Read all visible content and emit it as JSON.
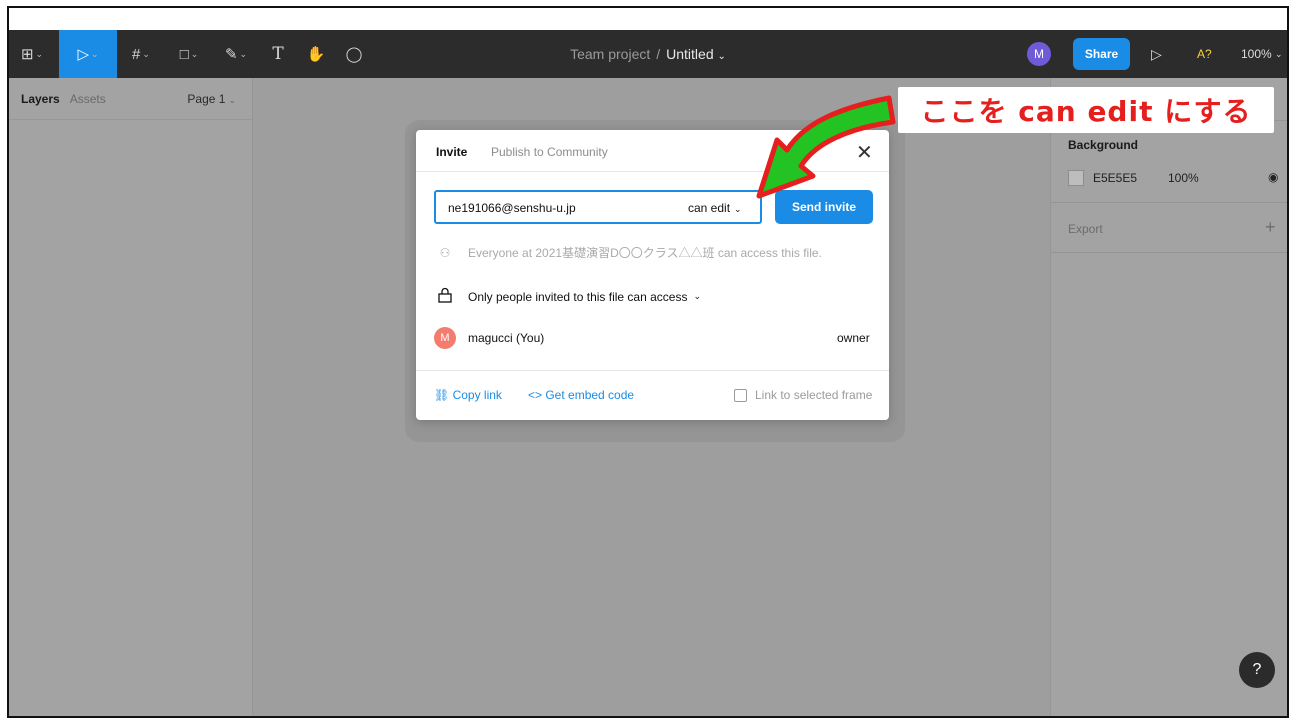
{
  "toolbar": {
    "tools": [
      {
        "name": "main-menu",
        "glyph": "⊞",
        "chev": "⌄"
      },
      {
        "name": "move-tool",
        "glyph": "▷",
        "chev": "⌄"
      },
      {
        "name": "frame-tool",
        "glyph": "#",
        "chev": "⌄"
      },
      {
        "name": "shape-tool",
        "glyph": "□",
        "chev": "⌄"
      },
      {
        "name": "pen-tool",
        "glyph": "✎",
        "chev": "⌄"
      },
      {
        "name": "text-tool",
        "glyph": "T",
        "chev": ""
      },
      {
        "name": "hand-tool",
        "glyph": "✋",
        "chev": ""
      },
      {
        "name": "comment-tool",
        "glyph": "◯",
        "chev": ""
      }
    ],
    "project": "Team project",
    "separator": "/",
    "file_name": "Untitled",
    "file_chev": "⌄",
    "avatar": "M",
    "share": "Share",
    "present": "▷",
    "font_badge": "A?",
    "zoom": "100%",
    "zoom_chev": "⌄",
    "accent": "#1a8ce6"
  },
  "left_panel": {
    "tab_layers": "Layers",
    "tab_assets": "Assets",
    "page": "Page 1",
    "page_chev": "⌄"
  },
  "right_panel": {
    "background_title": "Background",
    "bg_hex": "E5E5E5",
    "bg_opacity": "100%",
    "eye": "◉",
    "export_title": "Export",
    "export_plus": "+"
  },
  "help": "?",
  "modal": {
    "tab_invite": "Invite",
    "tab_publish": "Publish to Community",
    "close": "✕",
    "email_value": "ne191066@senshu-u.jp",
    "permission": "can edit",
    "permission_chev": "⌄",
    "send_invite": "Send invite",
    "everyone_icon": "⚇",
    "everyone_text": "Everyone at 2021基礎演習D〇〇クラス△△班 can access this file.",
    "lock_icon": "🔒",
    "access_text": "Only people invited to this file can access",
    "access_chev": "⌄",
    "me_initial": "M",
    "me_name": "magucci (You)",
    "me_role": "owner",
    "copy_link": "⛓ Copy link",
    "embed_code": "<> Get embed code",
    "link_frame": "Link to selected frame"
  },
  "annotation": {
    "text": "ここを can edit にする",
    "color": "#e51e1e",
    "arrow_color": "#22c322"
  }
}
